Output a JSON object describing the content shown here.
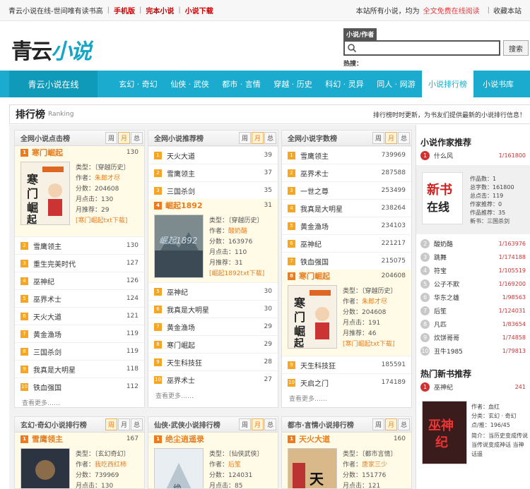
{
  "topbar": {
    "slogan": "青云小说在线-世间唯有读书高",
    "link1": "手机版",
    "link2": "完本小说",
    "link3": "小说下载",
    "right_text": "本站所有小说，均为",
    "right_red": "全文免费在线阅读",
    "bookmark": "收藏本站"
  },
  "logo": {
    "part1": "青云",
    "part2": "小说"
  },
  "search": {
    "tab": "小说/作者",
    "button": "搜索",
    "hot_label": "热搜："
  },
  "nav": {
    "brand": "青云小说在线",
    "items": [
      "玄幻 · 奇幻",
      "仙侠 · 武侠",
      "都市 · 言情",
      "穿越 · 历史",
      "科幻 · 灵异",
      "同人 · 网游",
      "小说排行榜",
      "小说书库"
    ]
  },
  "rank": {
    "title": "排行榜",
    "subtitle": "Ranking",
    "note": "排行榜时时更新，为书友们提供最新的小说排行信息！"
  },
  "tabs": {
    "week": "周",
    "month": "月",
    "total": "总"
  },
  "labels": {
    "type": "类型：",
    "author": "作者：",
    "total": "总点击：",
    "points": "分数：",
    "month": "月点击：",
    "monthrec": "月推荐：",
    "more": "查看更多……",
    "works": "作品数：",
    "allclicks": "总字数：",
    "allc2": "总点击：",
    "authrec": "作家推荐：",
    "workrec": "作品推荐：",
    "newbook": "新书："
  },
  "col1": {
    "title": "全网小说点击榜",
    "feat": {
      "name": "寒门崛起",
      "count": "130",
      "type": "〔穿越历史〕",
      "author": "朱郎才尽",
      "total": "204608",
      "month": "130",
      "monthrec": "29",
      "dl": "[寒门崛起txt下载]"
    },
    "rows": [
      {
        "n": "2",
        "name": "雪鹰领主",
        "c": "130"
      },
      {
        "n": "3",
        "name": "重生完美时代",
        "c": "127"
      },
      {
        "n": "4",
        "name": "巫神纪",
        "c": "126"
      },
      {
        "n": "5",
        "name": "巫界术士",
        "c": "124"
      },
      {
        "n": "6",
        "name": "天火大道",
        "c": "121"
      },
      {
        "n": "7",
        "name": "黄金渔场",
        "c": "119"
      },
      {
        "n": "8",
        "name": "三国杀剑",
        "c": "119"
      },
      {
        "n": "9",
        "name": "我真是大明星",
        "c": "118"
      },
      {
        "n": "10",
        "name": "铁血强国",
        "c": "112"
      }
    ]
  },
  "col2": {
    "title": "全网小说推荐榜",
    "top": [
      {
        "n": "1",
        "name": "天火大道",
        "c": "39"
      },
      {
        "n": "2",
        "name": "雪鹰领主",
        "c": "37"
      },
      {
        "n": "3",
        "name": "三国杀剑",
        "c": "35"
      }
    ],
    "feat": {
      "n": "4",
      "name": "崛起1892",
      "count": "31",
      "type": "〔穿越历史〕",
      "author": "酸奶酪",
      "total": "163976",
      "month": "110",
      "monthrec": "31",
      "dl": "[崛起1892txt下载]"
    },
    "rows": [
      {
        "n": "5",
        "name": "巫神纪",
        "c": "30"
      },
      {
        "n": "6",
        "name": "我真是大明星",
        "c": "30"
      },
      {
        "n": "7",
        "name": "黄金渔场",
        "c": "29"
      },
      {
        "n": "8",
        "name": "寒门崛起",
        "c": "29"
      },
      {
        "n": "9",
        "name": "天生科技狂",
        "c": "28"
      },
      {
        "n": "10",
        "name": "巫界术士",
        "c": "27"
      }
    ]
  },
  "col3": {
    "title": "全网小说字数榜",
    "top": [
      {
        "n": "1",
        "name": "雪鹰领主",
        "c": "739969"
      },
      {
        "n": "2",
        "name": "巫界术士",
        "c": "287588"
      },
      {
        "n": "3",
        "name": "一世之尊",
        "c": "253499"
      },
      {
        "n": "4",
        "name": "我真是大明星",
        "c": "238264"
      },
      {
        "n": "5",
        "name": "黄金渔场",
        "c": "234103"
      },
      {
        "n": "6",
        "name": "巫神纪",
        "c": "221217"
      },
      {
        "n": "7",
        "name": "铁血强国",
        "c": "215075"
      }
    ],
    "feat": {
      "n": "8",
      "name": "寒门崛起",
      "count": "204608",
      "type": "〔穿越历史〕",
      "author": "朱郎才尽",
      "total": "204608",
      "points": "191",
      "monthrec": "46",
      "dl": "[寒门崛起txt下载]"
    },
    "rows": [
      {
        "n": "9",
        "name": "天生科技狂",
        "c": "185591"
      },
      {
        "n": "10",
        "name": "天启之门",
        "c": "174189"
      }
    ]
  },
  "row2": {
    "c1": {
      "title": "玄幻·奇幻小说排行榜",
      "name": "雪鹰领主",
      "count": "167",
      "type": "〔玄幻奇幻〕",
      "author": "我吃西红柿",
      "total": "739969",
      "month": "130"
    },
    "c2": {
      "title": "仙侠·武侠小说排行榜",
      "name": "绝尘逍遥录",
      "count": "",
      "type": "〔仙侠武侠〕",
      "author": "后笙",
      "total": "124031",
      "month": "85"
    },
    "c3": {
      "title": "都市·言情小说排行榜",
      "name": "天火大道",
      "count": "160",
      "type": "〔都市言情〕",
      "author": "唐家三少",
      "total": "151776",
      "month": "121"
    }
  },
  "side": {
    "authors_title": "小说作家推荐",
    "first": {
      "n": "1",
      "name": "什么风",
      "v": "1/161800"
    },
    "card": {
      "works": "1",
      "words": "161800",
      "clicks": "119",
      "authrec": "0",
      "workrec": "35",
      "newbook": "三国杀剑"
    },
    "list": [
      {
        "n": "2",
        "name": "酸奶酪",
        "v": "1/163976"
      },
      {
        "n": "3",
        "name": "跳舞",
        "v": "1/174188"
      },
      {
        "n": "4",
        "name": "符宝",
        "v": "1/105519"
      },
      {
        "n": "5",
        "name": "公子不欺",
        "v": "1/169200"
      },
      {
        "n": "6",
        "name": "华东之雄",
        "v": "1/98563"
      },
      {
        "n": "7",
        "name": "后笙",
        "v": "1/124031"
      },
      {
        "n": "8",
        "name": "凡匹",
        "v": "1/83654"
      },
      {
        "n": "9",
        "name": "炊饼哥哥",
        "v": "1/74858"
      },
      {
        "n": "10",
        "name": "丑牛1985",
        "v": "1/79813"
      }
    ],
    "new_title": "热门新书推荐",
    "new_first": {
      "n": "1",
      "name": "巫神纪",
      "v": "241"
    },
    "newbook": {
      "author_label": "作者：",
      "author": "血红",
      "type_label": "分类：",
      "type": "玄幻 · 奇幻",
      "click_label": "点/推：",
      "click": "196/45",
      "intro_label": "简介：",
      "intro": "当历史变成传说 当传说变成神话 当神话遥"
    }
  }
}
